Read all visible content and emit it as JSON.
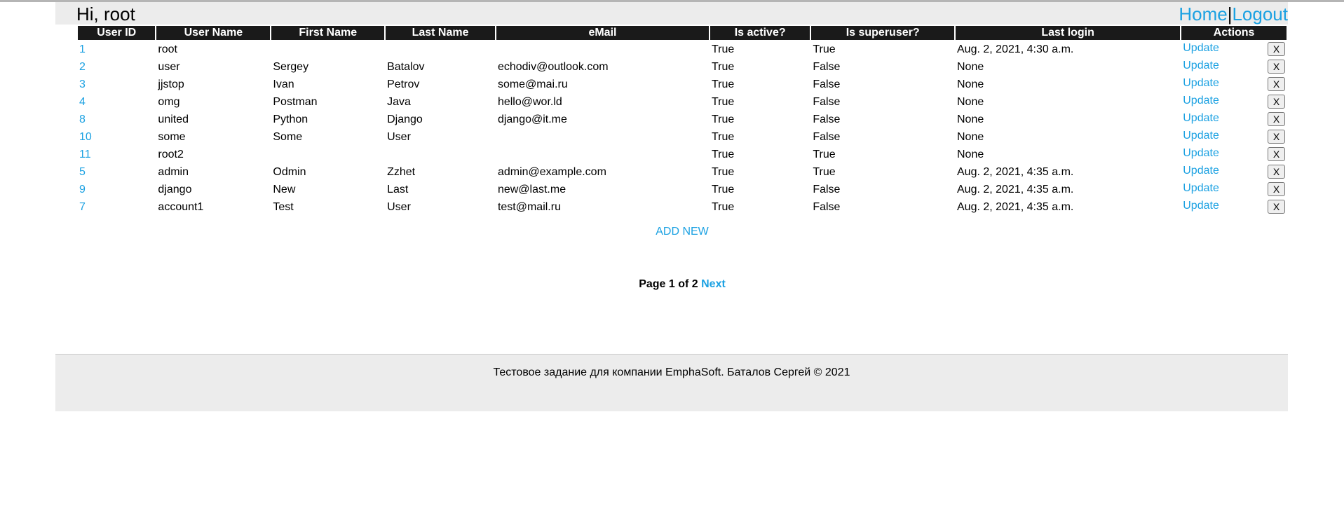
{
  "header": {
    "greeting": "Hi, root",
    "nav": {
      "home": "Home",
      "separator": "|",
      "logout": "Logout"
    }
  },
  "table": {
    "columns": [
      "User ID",
      "User Name",
      "First Name",
      "Last Name",
      "eMail",
      "Is active?",
      "Is superuser?",
      "Last login",
      "Actions"
    ],
    "update_label": "Update",
    "delete_label": "X",
    "rows": [
      {
        "id": "1",
        "username": "root",
        "first": "",
        "last": "",
        "email": "",
        "active": "True",
        "superuser": "True",
        "last_login": "Aug. 2, 2021, 4:30 a.m."
      },
      {
        "id": "2",
        "username": "user",
        "first": "Sergey",
        "last": "Batalov",
        "email": "echodiv@outlook.com",
        "active": "True",
        "superuser": "False",
        "last_login": "None"
      },
      {
        "id": "3",
        "username": "jjstop",
        "first": "Ivan",
        "last": "Petrov",
        "email": "some@mai.ru",
        "active": "True",
        "superuser": "False",
        "last_login": "None"
      },
      {
        "id": "4",
        "username": "omg",
        "first": "Postman",
        "last": "Java",
        "email": "hello@wor.ld",
        "active": "True",
        "superuser": "False",
        "last_login": "None"
      },
      {
        "id": "8",
        "username": "united",
        "first": "Python",
        "last": "Django",
        "email": "django@it.me",
        "active": "True",
        "superuser": "False",
        "last_login": "None"
      },
      {
        "id": "10",
        "username": "some",
        "first": "Some",
        "last": "User",
        "email": "",
        "active": "True",
        "superuser": "False",
        "last_login": "None"
      },
      {
        "id": "11",
        "username": "root2",
        "first": "",
        "last": "",
        "email": "",
        "active": "True",
        "superuser": "True",
        "last_login": "None"
      },
      {
        "id": "5",
        "username": "admin",
        "first": "Odmin",
        "last": "Zzhet",
        "email": "admin@example.com",
        "active": "True",
        "superuser": "True",
        "last_login": "Aug. 2, 2021, 4:35 a.m."
      },
      {
        "id": "9",
        "username": "django",
        "first": "New",
        "last": "Last",
        "email": "new@last.me",
        "active": "True",
        "superuser": "False",
        "last_login": "Aug. 2, 2021, 4:35 a.m."
      },
      {
        "id": "7",
        "username": "account1",
        "first": "Test",
        "last": "User",
        "email": "test@mail.ru",
        "active": "True",
        "superuser": "False",
        "last_login": "Aug. 2, 2021, 4:35 a.m."
      }
    ]
  },
  "add_new": "ADD NEW",
  "pagination": {
    "label": "Page 1 of 2",
    "next": "Next"
  },
  "footer": {
    "text": "Тестовое задание для компании EmphaSoft. Баталов Сергей © 2021"
  },
  "colors": {
    "link": "#1ba1e2",
    "header_bg": "#1a1a1a",
    "panel_bg": "#ececec"
  }
}
